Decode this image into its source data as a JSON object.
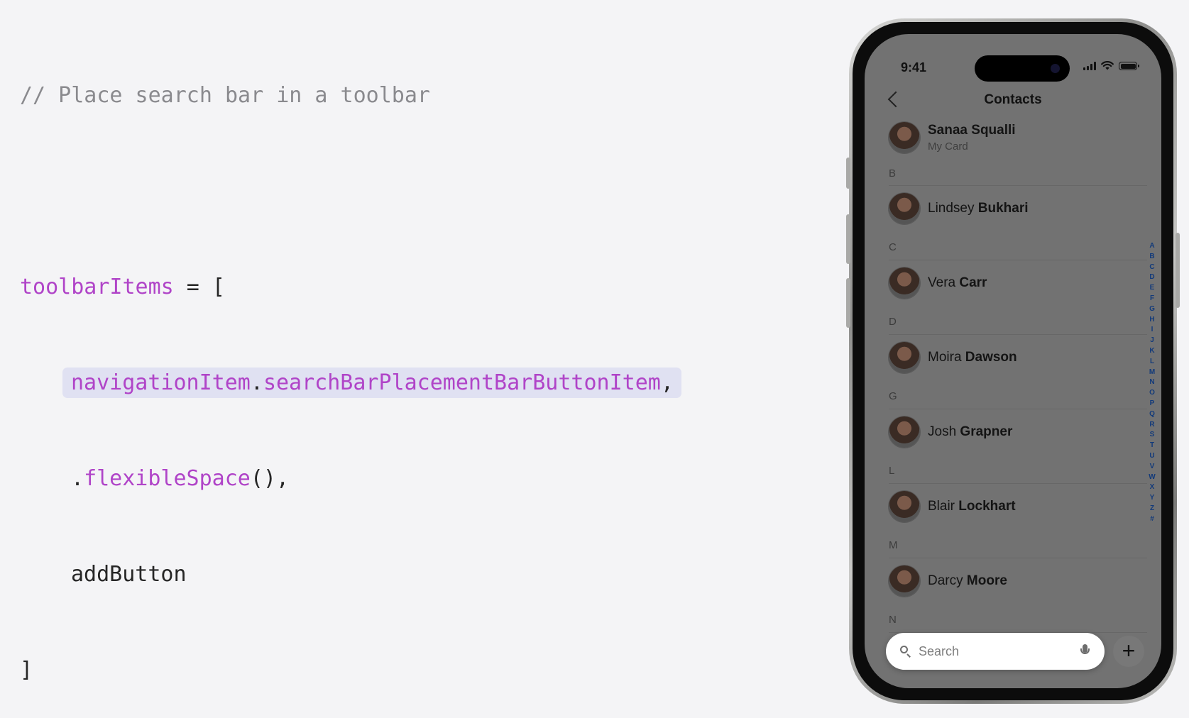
{
  "code": {
    "comment": "// Place search bar in a toolbar",
    "line1_var": "toolbarItems",
    "line1_rest": " = [",
    "line2_obj": "navigationItem",
    "line2_dot": ".",
    "line2_prop": "searchBarPlacementBarButtonItem",
    "line2_comma": ",",
    "line3_dot": ".",
    "line3_call": "flexibleSpace",
    "line3_rest": "(),",
    "line4": "addButton",
    "line5": "]"
  },
  "phone": {
    "time": "9:41",
    "nav_title": "Contacts",
    "my_card": {
      "first": "Sanaa",
      "last": "Squalli",
      "subtitle": "My Card"
    },
    "sections": [
      {
        "letter": "B",
        "first": "Lindsey",
        "last": "Bukhari"
      },
      {
        "letter": "C",
        "first": "Vera",
        "last": "Carr"
      },
      {
        "letter": "D",
        "first": "Moira",
        "last": "Dawson"
      },
      {
        "letter": "G",
        "first": "Josh",
        "last": "Grapner"
      },
      {
        "letter": "L",
        "first": "Blair",
        "last": "Lockhart"
      },
      {
        "letter": "M",
        "first": "Darcy",
        "last": "Moore"
      },
      {
        "letter": "N"
      }
    ],
    "index_letters": [
      "A",
      "B",
      "C",
      "D",
      "E",
      "F",
      "G",
      "H",
      "I",
      "J",
      "K",
      "L",
      "M",
      "N",
      "O",
      "P",
      "Q",
      "R",
      "S",
      "T",
      "U",
      "V",
      "W",
      "X",
      "Y",
      "Z",
      "#"
    ],
    "search_placeholder": "Search",
    "add_symbol": "+"
  }
}
